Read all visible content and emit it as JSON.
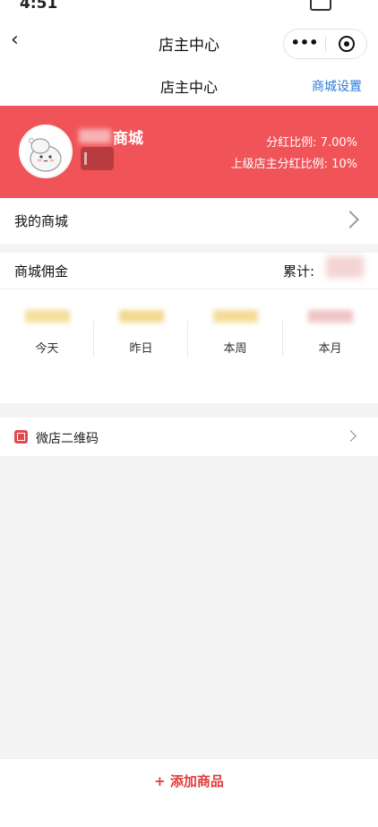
{
  "status_bar": {
    "time": "4:51"
  },
  "navbar": {
    "title": "店主中心",
    "more": "•••"
  },
  "subheader": {
    "title": "店主中心",
    "settings_label": "商城设置"
  },
  "banner": {
    "shop_name": "商城",
    "dividend_ratio_label": "分红比例:",
    "dividend_ratio_value": "7.00%",
    "parent_ratio_label": "上级店主分红比例:",
    "parent_ratio_value": "10%"
  },
  "my_shop": {
    "label": "我的商城"
  },
  "commission": {
    "title": "商城佣金",
    "total_label": "累计:",
    "periods": [
      "今天",
      "昨日",
      "本周",
      "本月"
    ]
  },
  "qrcode": {
    "label": "微店二维码"
  },
  "bottom": {
    "add_label": "+ 添加商品"
  },
  "colors": {
    "accent": "#f05458",
    "link": "#2a7bd8",
    "add": "#e4393c"
  }
}
